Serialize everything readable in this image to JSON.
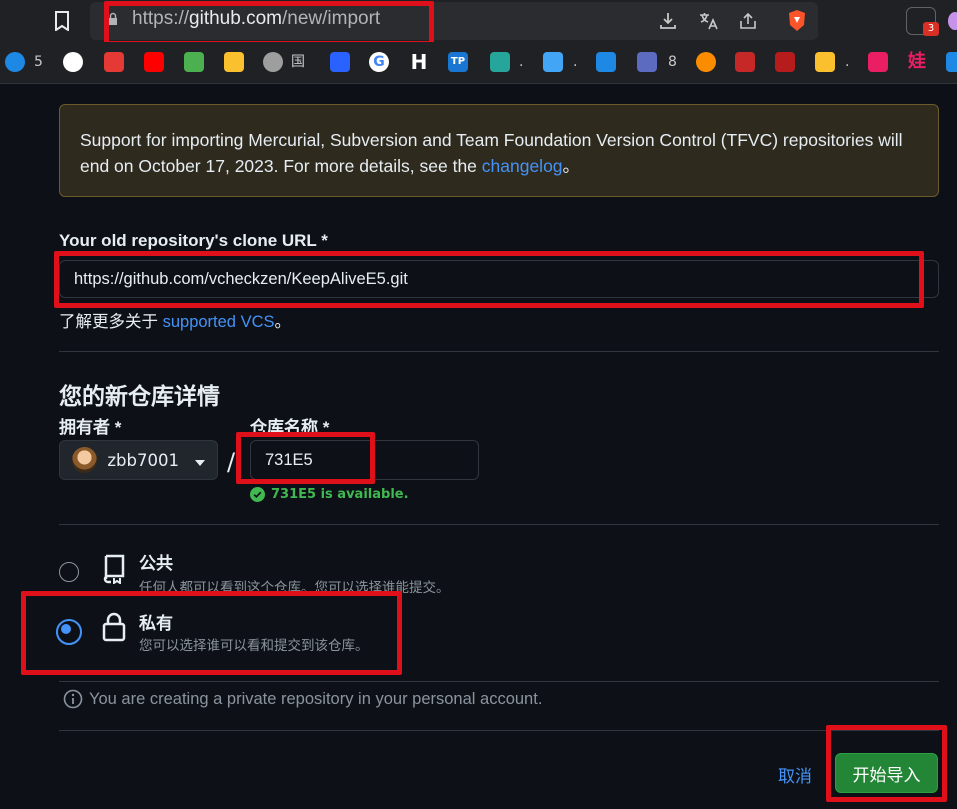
{
  "browser": {
    "url_prefix": "https://",
    "url_host": "github.com",
    "url_path": "/new/import",
    "extension_badge": "3",
    "bookmarks": [
      {
        "icon": "cloud-icon",
        "label": "5",
        "color": "#1e88e5"
      },
      {
        "icon": "github-icon",
        "label": "",
        "color": "#ffffff"
      },
      {
        "icon": "red-logo-icon",
        "label": "",
        "color": "#e53935"
      },
      {
        "icon": "youtube-icon",
        "label": "",
        "color": "#ff0000"
      },
      {
        "icon": "cube-icon",
        "label": "",
        "color": "#4caf50"
      },
      {
        "icon": "yellow-logo-icon",
        "label": "",
        "color": "#fbc02d"
      },
      {
        "icon": "globe-icon",
        "label": "国",
        "color": "#9e9e9e"
      },
      {
        "icon": "baidu-icon",
        "label": "",
        "color": "#2962ff"
      },
      {
        "icon": "google-icon",
        "label": "",
        "color": "#4285f4"
      },
      {
        "icon": "h-icon",
        "label": "",
        "color": "#111111"
      },
      {
        "icon": "tp-icon",
        "label": "",
        "color": "#1976d2"
      },
      {
        "icon": "triangle-icon",
        "label": ".",
        "color": "#26a69a"
      },
      {
        "icon": "cloud-blue-icon",
        "label": ".",
        "color": "#42a5f5"
      },
      {
        "icon": "flower-icon",
        "label": "",
        "color": "#1e88e5"
      },
      {
        "icon": "c-logo-icon",
        "label": "8",
        "color": "#5c6bc0"
      },
      {
        "icon": "orange-ball-icon",
        "label": "",
        "color": "#fb8c00"
      },
      {
        "icon": "red-square-icon",
        "label": "",
        "color": "#c62828"
      },
      {
        "icon": "seal-icon",
        "label": "",
        "color": "#b71c1c"
      },
      {
        "icon": "plane-icon",
        "label": ".",
        "color": "#fbc02d"
      },
      {
        "icon": "grid-logo-icon",
        "label": "",
        "color": "#e91e63"
      },
      {
        "icon": "wa-icon",
        "label": "",
        "color": "#e91e63"
      },
      {
        "icon": "play-icon",
        "label": "",
        "color": "#1e88e5"
      }
    ]
  },
  "notice": {
    "text_before": "Support for importing Mercurial, Subversion and Team Foundation Version Control (TFVC) repositories will end on October 17, 2023. For more details, see the ",
    "link": "changelog",
    "text_after": "。"
  },
  "clone_url": {
    "label": "Your old repository's clone URL *",
    "value": "https://github.com/vcheckzen/KeepAliveE5.git",
    "hint_before": "了解更多关于 ",
    "hint_link": "supported VCS",
    "hint_after": "。"
  },
  "new_repo": {
    "heading": "您的新仓库详情",
    "owner_label": "拥有者 *",
    "owner": "zbb7001",
    "separator": "/",
    "name_label": "仓库名称 *",
    "name_value": "731E5",
    "available_msg": "731E5 is available."
  },
  "visibility": {
    "options": [
      {
        "title": "公共",
        "desc": "任何人都可以看到这个仓库。您可以选择谁能提交。",
        "checked": false
      },
      {
        "title": "私有",
        "desc": "您可以选择谁可以看和提交到该仓库。",
        "checked": true
      }
    ],
    "info": "You are creating a private repository in your personal account."
  },
  "actions": {
    "cancel": "取消",
    "submit": "开始导入"
  },
  "colors": {
    "background": "#0d1117",
    "link": "#4493f8",
    "primary_button": "#238636",
    "success": "#3fb950",
    "annotation_red": "#e0101a",
    "notice_bg": "#2f2a1e"
  }
}
